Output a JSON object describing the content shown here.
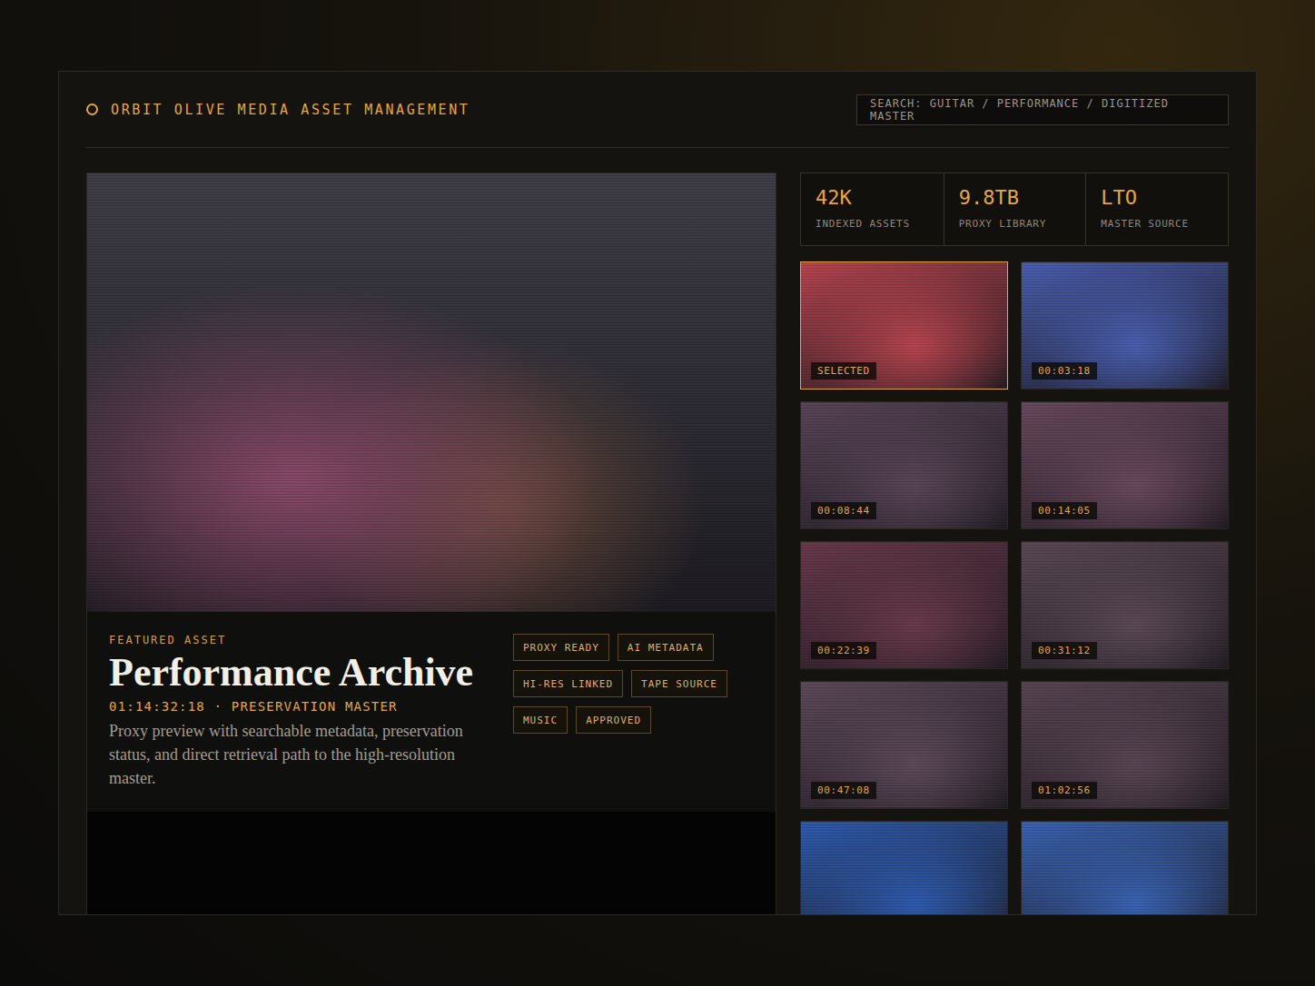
{
  "header": {
    "logo_text": "ORBIT OLIVE MEDIA ASSET MANAGEMENT",
    "search": "SEARCH: GUITAR / PERFORMANCE / DIGITIZED MASTER"
  },
  "featured": {
    "eyebrow": "FEATURED ASSET",
    "title": "Performance Archive",
    "timecode": "01:14:32:18 · PRESERVATION MASTER",
    "description": "Proxy preview with searchable metadata, preservation status, and direct retrieval path to the high-resolution master.",
    "tags": [
      "PROXY READY",
      "AI METADATA",
      "HI-RES LINKED",
      "TAPE SOURCE",
      "MUSIC",
      "APPROVED"
    ]
  },
  "stats": [
    {
      "value": "42K",
      "label": "INDEXED ASSETS"
    },
    {
      "value": "9.8TB",
      "label": "PROXY LIBRARY"
    },
    {
      "value": "LTO",
      "label": "MASTER SOURCE"
    }
  ],
  "thumbnails": [
    {
      "label": "SELECTED",
      "selected": true,
      "color": "#b8454f"
    },
    {
      "label": "00:03:18",
      "selected": false,
      "color": "#4a5fb0"
    },
    {
      "label": "00:08:44",
      "selected": false,
      "color": "#5a4658"
    },
    {
      "label": "00:14:05",
      "selected": false,
      "color": "#6a4a5e"
    },
    {
      "label": "00:22:39",
      "selected": false,
      "color": "#6a3a4c"
    },
    {
      "label": "00:31:12",
      "selected": false,
      "color": "#5c4a56"
    },
    {
      "label": "00:47:08",
      "selected": false,
      "color": "#5e4a5a"
    },
    {
      "label": "01:02:56",
      "selected": false,
      "color": "#5a4654"
    },
    {
      "label": "",
      "selected": false,
      "color": "#2f5cb0"
    },
    {
      "label": "",
      "selected": false,
      "color": "#3a64b4"
    }
  ]
}
